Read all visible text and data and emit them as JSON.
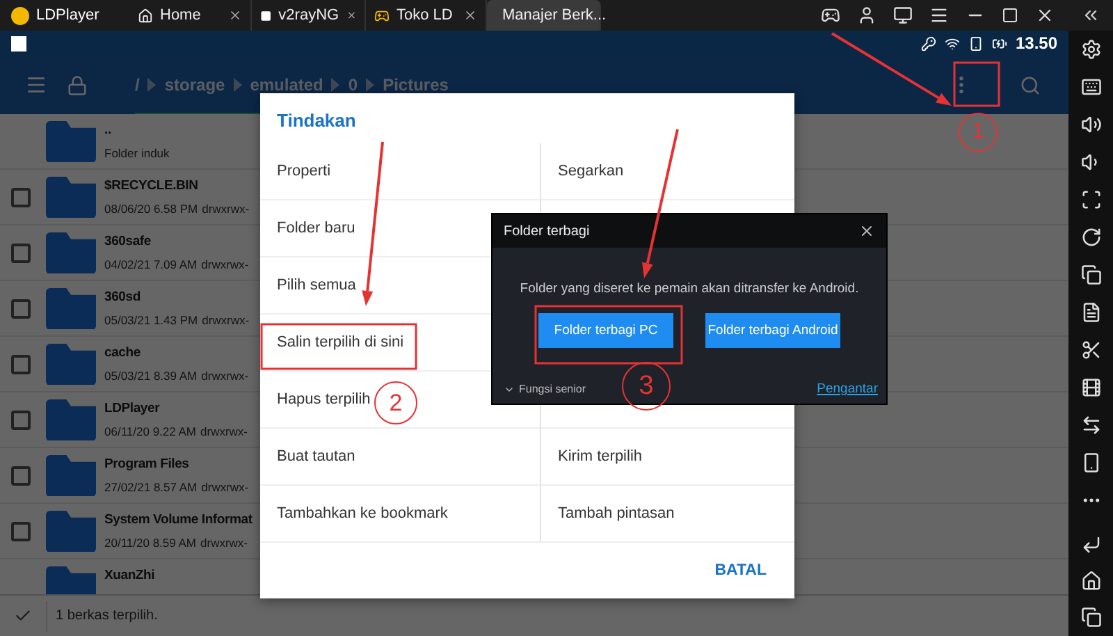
{
  "titlebar": {
    "app_name": "LDPlayer",
    "tabs": [
      {
        "kind": "home",
        "label": "Home",
        "selected": false
      },
      {
        "kind": "v2ray",
        "label": "v2rayNG",
        "selected": false
      },
      {
        "kind": "game",
        "label": "Toko LD",
        "selected": false
      },
      {
        "kind": "folder",
        "label": "Manajer Berk...",
        "selected": true
      }
    ]
  },
  "status_bar": {
    "time": "13.50"
  },
  "toolbar": {
    "path": [
      "/",
      "storage",
      "emulated",
      "0",
      "Pictures"
    ]
  },
  "files": [
    {
      "name": "..",
      "detail": "Folder induk"
    },
    {
      "name": "$RECYCLE.BIN",
      "date": "08/06/20 6.58 PM",
      "permissions": "drwxrwx-",
      "checked": false
    },
    {
      "name": "360safe",
      "date": "04/02/21 7.09 AM",
      "permissions": "drwxrwx-",
      "checked": false
    },
    {
      "name": "360sd",
      "date": "05/03/21 1.43 PM",
      "permissions": "drwxrwx-",
      "checked": false
    },
    {
      "name": "cache",
      "date": "05/03/21 8.39 AM",
      "permissions": "drwxrwx-",
      "checked": false
    },
    {
      "name": "LDPlayer",
      "date": "06/11/20 9.22 AM",
      "permissions": "drwxrwx-",
      "checked": false
    },
    {
      "name": "Program Files",
      "date": "27/02/21 8.57 AM",
      "permissions": "drwxrwx-",
      "checked": false
    },
    {
      "name": "System Volume Informat",
      "date": "20/11/20 8.59 AM",
      "permissions": "drwxrwx-",
      "checked": false
    },
    {
      "name": "XuanZhi"
    }
  ],
  "footer": {
    "selection": "1 berkas terpilih."
  },
  "actions_dialog": {
    "title": "Tindakan",
    "rows": [
      {
        "left": "Properti",
        "right": "Segarkan"
      },
      {
        "left": "Folder baru"
      },
      {
        "left": "Pilih semua"
      },
      {
        "left": "Salin terpilih di sini"
      },
      {
        "left": "Hapus terpilih"
      },
      {
        "left": "Buat tautan",
        "right": "Kirim terpilih"
      },
      {
        "left": "Tambahkan ke bookmark",
        "right": "Tambah pintasan"
      }
    ],
    "cancel": "BATAL"
  },
  "share_dialog": {
    "title": "Folder terbagi",
    "message": "Folder yang diseret ke pemain akan ditransfer ke Android.",
    "buttons": [
      "Folder terbagi PC",
      "Folder terbagi Android"
    ],
    "advanced": "Fungsi senior",
    "help_link": "Pengantar"
  },
  "annotations": {
    "steps": [
      "1",
      "2",
      "3"
    ]
  }
}
